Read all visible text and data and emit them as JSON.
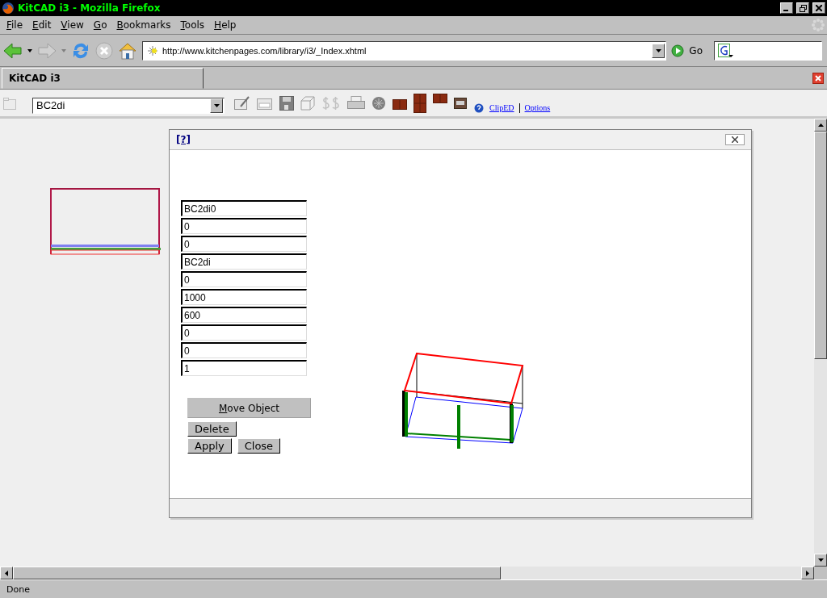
{
  "window": {
    "title": "KitCAD i3 - Mozilla Firefox"
  },
  "menu": [
    {
      "label": "File"
    },
    {
      "label": "Edit"
    },
    {
      "label": "View"
    },
    {
      "label": "Go"
    },
    {
      "label": "Bookmarks"
    },
    {
      "label": "Tools"
    },
    {
      "label": "Help"
    }
  ],
  "navigation": {
    "address": "http://www.kitchenpages.com/library/i3/_Index.xhtml",
    "go_label": "Go"
  },
  "tabs": [
    {
      "label": "KitCAD i3",
      "selected": true
    }
  ],
  "page_toolbar": {
    "object_select": "BC2di",
    "links": [
      "ClipED",
      "Options"
    ]
  },
  "dialog": {
    "help": "[?]",
    "fields": [
      "BC2di0",
      "0",
      "0",
      "BC2di",
      "0",
      "1000",
      "600",
      "0",
      "0",
      "1"
    ],
    "move_button": "Move Object",
    "delete_button": "Delete",
    "apply_button": "Apply",
    "close_button": "Close"
  },
  "status_bar": {
    "text": "Done"
  }
}
